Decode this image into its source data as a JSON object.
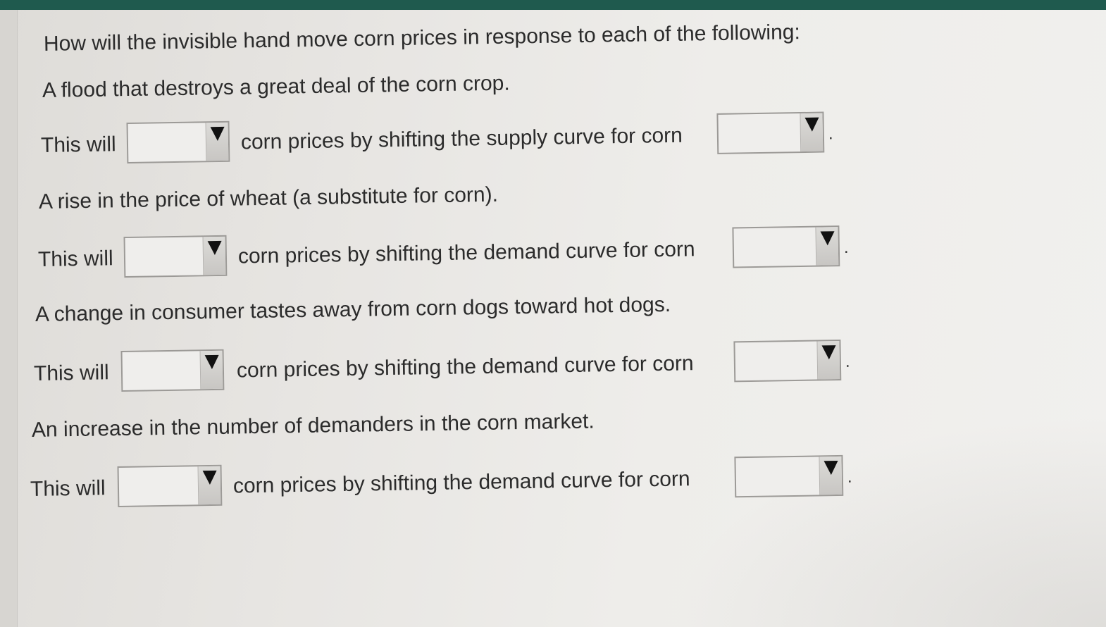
{
  "question": "How will the invisible hand move corn prices in response to each of the following:",
  "items": [
    {
      "scenario": "A flood that destroys a great deal of the corn crop.",
      "lead": "This will",
      "middle": "corn prices by shifting the supply curve for corn",
      "end": ".",
      "select_1": "",
      "select_2": ""
    },
    {
      "scenario": "A rise in the price of wheat (a substitute for corn).",
      "lead": "This will",
      "middle": "corn prices by shifting the demand curve for corn",
      "end": ".",
      "select_1": "",
      "select_2": ""
    },
    {
      "scenario": "A change in consumer tastes away from corn dogs toward hot dogs.",
      "lead": "This will",
      "middle": "corn prices by shifting the demand curve for corn",
      "end": ".",
      "select_1": "",
      "select_2": ""
    },
    {
      "scenario": "An increase in the number of demanders in the corn market.",
      "lead": "This will",
      "middle": "corn prices by shifting the demand curve for corn",
      "end": ".",
      "select_1": "",
      "select_2": ""
    }
  ],
  "icons": {
    "dropdown": "triangle-down-icon"
  }
}
